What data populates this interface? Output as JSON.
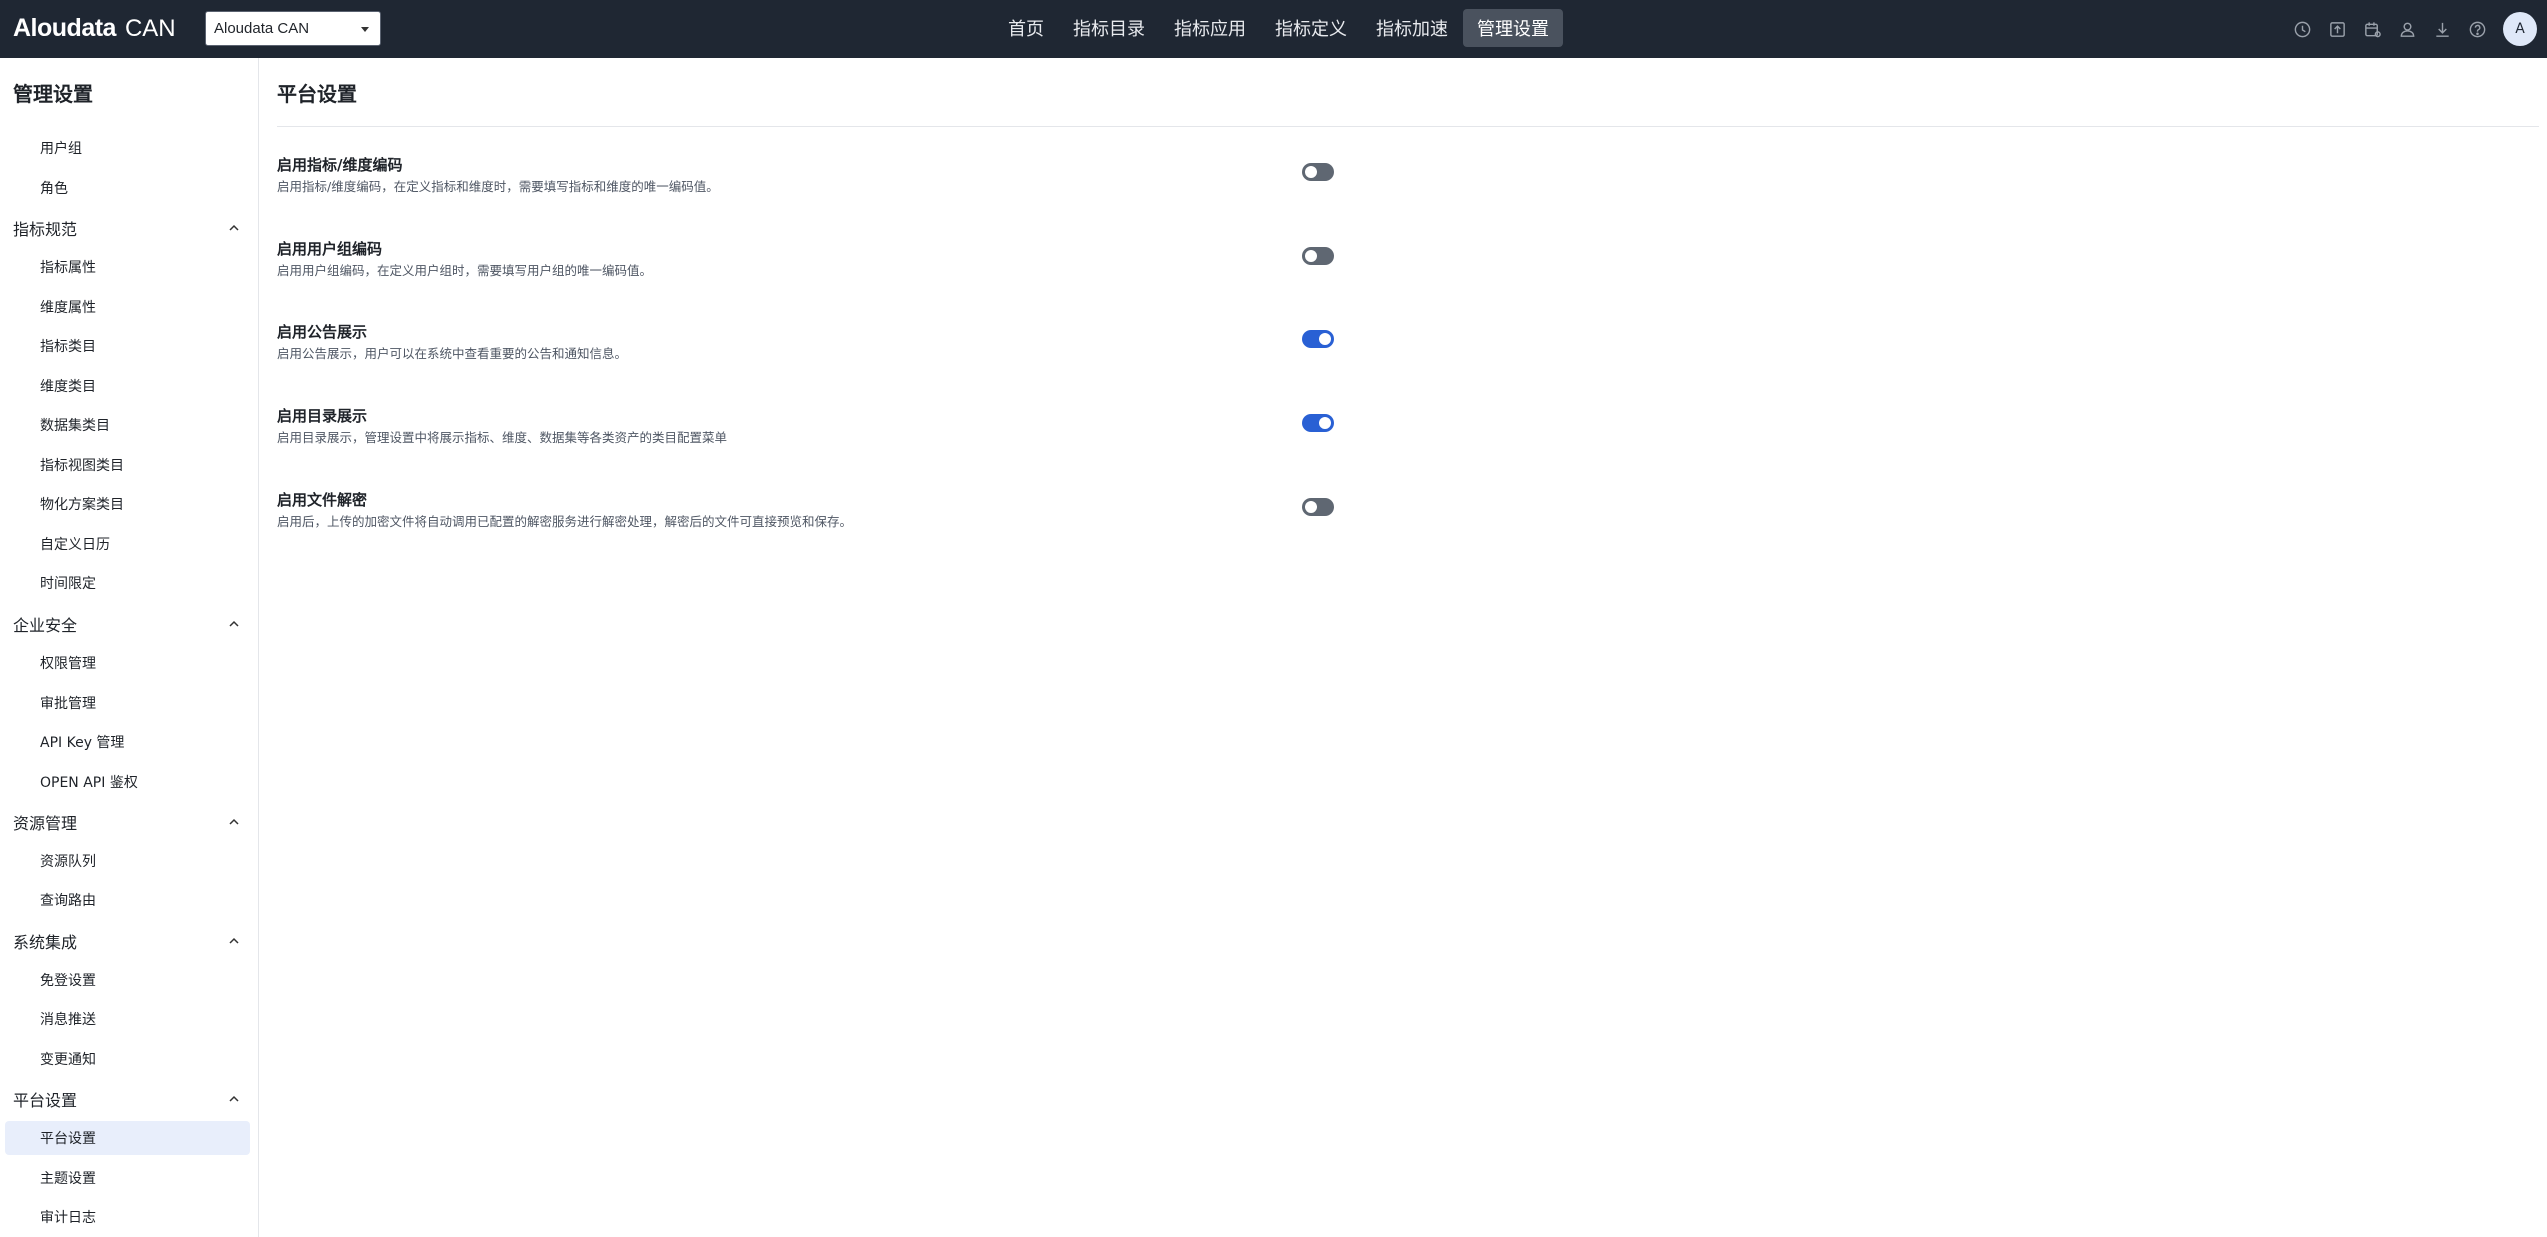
{
  "header": {
    "logo_main": "Aloudata",
    "logo_sub": "CAN",
    "workspace": "Aloudata CAN",
    "nav": [
      {
        "label": "首页",
        "active": false
      },
      {
        "label": "指标目录",
        "active": false
      },
      {
        "label": "指标应用",
        "active": false
      },
      {
        "label": "指标定义",
        "active": false
      },
      {
        "label": "指标加速",
        "active": false
      },
      {
        "label": "管理设置",
        "active": true
      }
    ],
    "tools": [
      "clock-icon",
      "upload-icon",
      "calendar-icon",
      "user-icon",
      "download-icon",
      "help-icon"
    ],
    "avatar": "A"
  },
  "sidebar": {
    "title": "管理设置",
    "top_items": [
      "用户组",
      "角色"
    ],
    "groups": [
      {
        "label": "指标规范",
        "items": [
          "指标属性",
          "维度属性",
          "指标类目",
          "维度类目",
          "数据集类目",
          "指标视图类目",
          "物化方案类目",
          "自定义日历",
          "时间限定"
        ]
      },
      {
        "label": "企业安全",
        "items": [
          "权限管理",
          "审批管理",
          "API Key 管理",
          "OPEN API 鉴权"
        ]
      },
      {
        "label": "资源管理",
        "items": [
          "资源队列",
          "查询路由"
        ]
      },
      {
        "label": "系统集成",
        "items": [
          "免登设置",
          "消息推送",
          "变更通知"
        ]
      },
      {
        "label": "平台设置",
        "items": [
          "平台设置",
          "主题设置",
          "审计日志"
        ]
      }
    ],
    "active_item": "平台设置"
  },
  "main": {
    "title": "平台设置",
    "settings": [
      {
        "title": "启用指标/维度编码",
        "desc": "启用指标/维度编码，在定义指标和维度时，需要填写指标和维度的唯一编码值。",
        "enabled": false
      },
      {
        "title": "启用用户组编码",
        "desc": "启用用户组编码，在定义用户组时，需要填写用户组的唯一编码值。",
        "enabled": false
      },
      {
        "title": "启用公告展示",
        "desc": "启用公告展示，用户可以在系统中查看重要的公告和通知信息。",
        "enabled": true
      },
      {
        "title": "启用目录展示",
        "desc": "启用目录展示，管理设置中将展示指标、维度、数据集等各类资产的类目配置菜单",
        "enabled": true
      },
      {
        "title": "启用文件解密",
        "desc": "启用后，上传的加密文件将自动调用已配置的解密服务进行解密处理，解密后的文件可直接预览和保存。",
        "enabled": false
      }
    ]
  },
  "colors": {
    "topbar": "#1f2733",
    "accent": "#2960d4",
    "toggle_off": "#5f6772",
    "active_menu_bg": "#e8eefb"
  }
}
